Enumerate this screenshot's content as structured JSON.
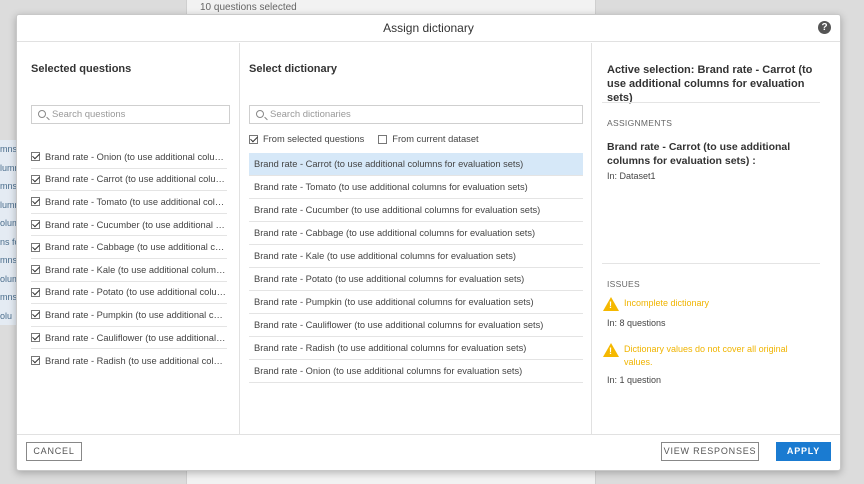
{
  "background": {
    "top_text": "10 questions selected",
    "left_fragments": [
      "mns",
      "lumn",
      "mns",
      "lumn",
      "olum",
      "ns fo",
      "mns",
      "olum",
      "mns",
      "olu"
    ]
  },
  "dialog": {
    "title": "Assign dictionary",
    "help_icon": "?"
  },
  "left": {
    "title": "Selected questions",
    "search_placeholder": "Search questions",
    "questions": [
      "Brand rate - Onion (to use additional columns for evaluation sets)",
      "Brand rate - Carrot (to use additional columns for evaluation sets)",
      "Brand rate - Tomato (to use additional columns for evaluation sets)",
      "Brand rate - Cucumber (to use additional columns for evaluation sets)",
      "Brand rate - Cabbage (to use additional columns for evaluation sets)",
      "Brand rate - Kale (to use additional columns for evaluation sets)",
      "Brand rate - Potato (to use additional columns for evaluation sets)",
      "Brand rate - Pumpkin (to use additional columns for evaluation sets)",
      "Brand rate - Cauliflower (to use additional columns for evaluation sets)",
      "Brand rate - Radish (to use additional columns for evaluation sets)"
    ]
  },
  "middle": {
    "title": "Select dictionary",
    "search_placeholder": "Search dictionaries",
    "filter_selected": "From selected questions",
    "filter_dataset": "From current dataset",
    "dictionaries": [
      "Brand rate - Carrot (to use additional columns for evaluation sets)",
      "Brand rate - Tomato (to use additional columns for evaluation sets)",
      "Brand rate - Cucumber (to use additional columns for evaluation sets)",
      "Brand rate - Cabbage (to use additional columns for evaluation sets)",
      "Brand rate - Kale (to use additional columns for evaluation sets)",
      "Brand rate - Potato (to use additional columns for evaluation sets)",
      "Brand rate - Pumpkin (to use additional columns for evaluation sets)",
      "Brand rate - Cauliflower (to use additional columns for evaluation sets)",
      "Brand rate - Radish (to use additional columns for evaluation sets)",
      "Brand rate - Onion (to use additional columns for evaluation sets)"
    ]
  },
  "right": {
    "active_selection": "Active selection: Brand rate - Carrot (to use additional columns for evaluation sets)",
    "assignments_label": "ASSIGNMENTS",
    "assignment_name": "Brand rate - Carrot (to use additional columns for evaluation sets) :",
    "assignment_in": "In:  Dataset1",
    "issues_label": "ISSUES",
    "issue1_text": "Incomplete dictionary",
    "issue1_in": "In:  8 questions",
    "issue2_text": "Dictionary values do not cover all original values.",
    "issue2_in": "In:  1 question"
  },
  "footer": {
    "cancel": "CANCEL",
    "view_responses": "VIEW RESPONSES",
    "apply": "APPLY"
  },
  "colors": {
    "accent": "#1a7bd1",
    "selected_row": "#d6e8f8",
    "warning": "#f5b800"
  }
}
